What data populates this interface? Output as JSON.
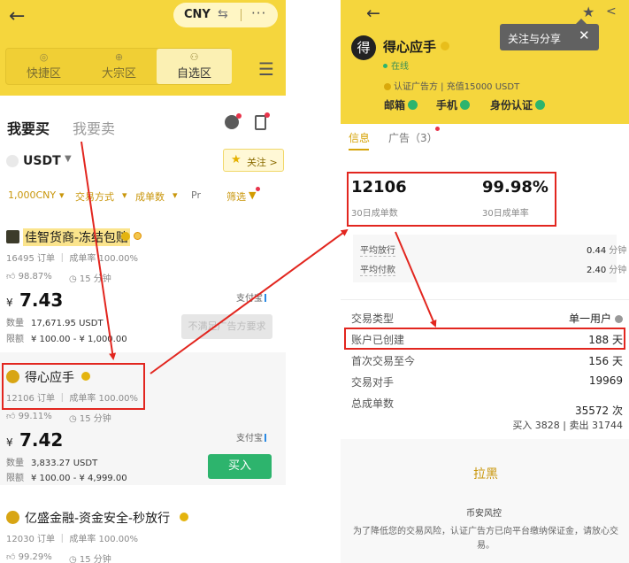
{
  "left": {
    "header": {
      "currency": "CNY",
      "modes": [
        {
          "label": "快捷区",
          "icon": "scan-icon"
        },
        {
          "label": "大宗区",
          "icon": "bulk-icon"
        },
        {
          "label": "自选区",
          "icon": "custom-icon"
        }
      ]
    },
    "tabs": {
      "buy": "我要买",
      "sell": "我要卖"
    },
    "coin": {
      "name": "USDT",
      "follow": "关注 >"
    },
    "filters": {
      "amount": "1,000CNY",
      "pay_method": "交易方式",
      "orders": "成单数",
      "pr": "Pr",
      "screen": "筛选"
    },
    "merchants": [
      {
        "name": "佳智货商-冻结包赔",
        "stats": "16495 订单 ｜ 成单率 100.00%",
        "likes": "98.87%",
        "time": "15 分钟",
        "price_symbol": "¥",
        "price": "7.43",
        "pay": "支付宝",
        "qty_label": "数量",
        "qty": "17,671.95 USDT",
        "limit_label": "限额",
        "limit": "¥ 100.00 - ¥ 1,000.00",
        "action": "不满足广告方要求"
      },
      {
        "name": "得心应手",
        "stats": "12106 订单 ｜ 成单率 100.00%",
        "likes": "99.11%",
        "time": "15 分钟",
        "price_symbol": "¥",
        "price": "7.42",
        "pay": "支付宝",
        "qty_label": "数量",
        "qty": "3,833.27 USDT",
        "limit_label": "限额",
        "limit": "¥ 100.00 - ¥ 4,999.00",
        "action": "买入"
      },
      {
        "name": "亿盛金融-资金安全-秒放行",
        "stats": "12030 订单 ｜ 成单率 100.00%",
        "likes": "99.29%",
        "time": "15 分钟"
      }
    ]
  },
  "right": {
    "tooltip": "关注与分享",
    "tooltip_close": "✕",
    "avatar_char": "得",
    "name": "得心应手",
    "status": "在线",
    "cert": "认证广告方 | 充值15000 USDT",
    "verifications": [
      "邮箱",
      "手机",
      "身份认证"
    ],
    "tabs": {
      "info": "信息",
      "ads": "广告（3）"
    },
    "orders_30d": "12106",
    "orders_30d_label": "30日成单数",
    "rate_30d": "99.98%",
    "rate_30d_label": "30日成单率",
    "avg_release_label": "平均放行",
    "avg_release": "0.44",
    "avg_pay_label": "平均付款",
    "avg_pay": "2.40",
    "minute_unit": "分钟",
    "rows": [
      {
        "key": "交易类型",
        "value": "单一用户"
      },
      {
        "key": "账户已创建",
        "value": "188 天"
      },
      {
        "key": "首次交易至今",
        "value": "156 天"
      },
      {
        "key": "交易对手",
        "value": "19969"
      },
      {
        "key": "总成单数",
        "value": "35572 次"
      }
    ],
    "total_detail": "买入 3828 | 卖出 31744",
    "block": "拉黑",
    "risk_title": "币安风控",
    "risk_text": "为了降低您的交易风险，认证广告方已向平台缴纳保证金，请放心交易。"
  },
  "colors": {
    "brand_yellow": "#f5d63d",
    "buy_green": "#2db46d",
    "annotation_red": "#e2261f",
    "link_gold": "#c9960b"
  }
}
